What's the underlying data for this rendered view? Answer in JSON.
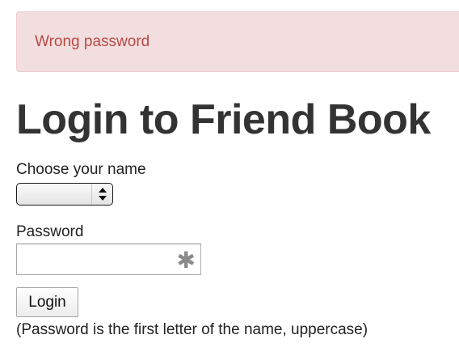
{
  "alert": {
    "message": "Wrong password",
    "color": "#b94a48",
    "background": "#f2dede"
  },
  "title": "Login to Friend Book",
  "name_field": {
    "label": "Choose your name",
    "selected_value": "",
    "icon": "select-arrows-icon"
  },
  "password_field": {
    "label": "Password",
    "value": "",
    "icon": "asterisk-icon",
    "icon_glyph": "✱"
  },
  "login_button": {
    "label": "Login"
  },
  "hint": "(Password is the first letter of the name, uppercase)"
}
